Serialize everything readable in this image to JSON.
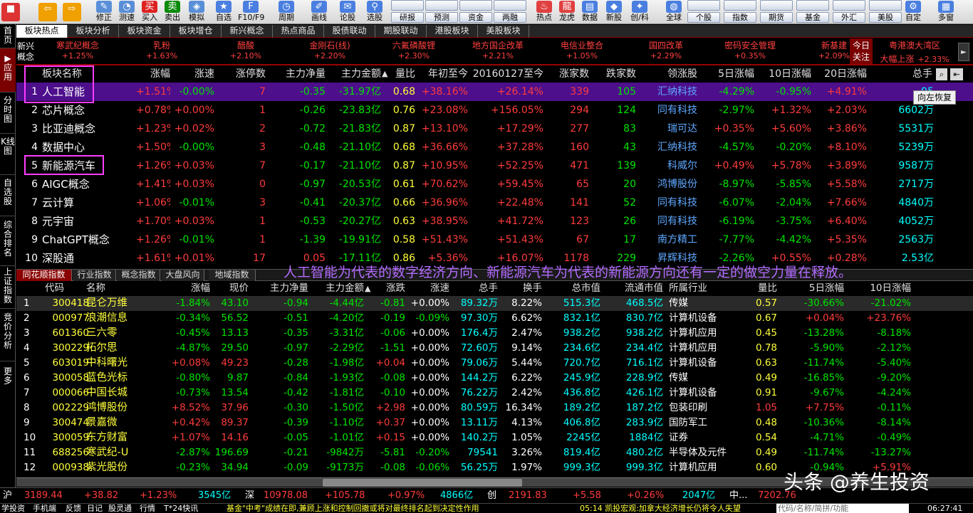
{
  "toolbar": {
    "buttons": [
      {
        "label": "",
        "icon": "app-logo-icon",
        "color": "#d33"
      },
      {
        "label": "",
        "icon": "back-arrow-icon",
        "color": "#f0a000"
      },
      {
        "label": "",
        "icon": "forward-arrow-icon",
        "color": "#f0a000"
      },
      {
        "label": "修正",
        "icon": "edit-icon",
        "color": "#5a8fd8"
      },
      {
        "label": "测速",
        "icon": "speed-icon",
        "color": "#5a8fd8"
      },
      {
        "label": "买入",
        "icon": "buy-icon",
        "color": "#d22"
      },
      {
        "label": "卖出",
        "icon": "sell-icon",
        "color": "#0a8a0a"
      },
      {
        "label": "模拟",
        "icon": "simulate-icon",
        "color": "#5a8fd8"
      },
      {
        "label": "自选",
        "icon": "star-icon",
        "color": "#4a7fe0"
      },
      {
        "label": "F10/F9",
        "icon": "f10-icon",
        "color": "#4a7fe0"
      },
      {
        "label": "周期",
        "icon": "clock-icon",
        "color": "#4a7fe0"
      },
      {
        "label": "画线",
        "icon": "pencil-icon",
        "color": "#4a7fe0"
      },
      {
        "label": "论股",
        "icon": "chat-icon",
        "color": "#4a7fe0"
      },
      {
        "label": "选股",
        "icon": "select-stock-icon",
        "color": "#4a7fe0"
      },
      {
        "label": "热点",
        "icon": "hotspot-icon",
        "color": "#e04040"
      },
      {
        "label": "龙虎",
        "icon": "dragon-tiger-icon",
        "color": "#e04040"
      },
      {
        "label": "数据",
        "icon": "data-icon",
        "color": "#4a7fe0"
      },
      {
        "label": "新股",
        "icon": "ipo-icon",
        "color": "#4a7fe0"
      },
      {
        "label": "创/科",
        "icon": "star-board-icon",
        "color": "#4a7fe0"
      },
      {
        "label": "全球",
        "icon": "globe-icon",
        "color": "#4a7fe0"
      },
      {
        "label": "自定",
        "icon": "customize-icon",
        "color": "#4a7fe0"
      },
      {
        "label": "多窗",
        "icon": "multi-window-icon",
        "color": "#4a7fe0"
      }
    ],
    "small_buttons": [
      "研报",
      "预测",
      "资金",
      "两融",
      "个股",
      "指数",
      "期货",
      "基金",
      "外汇",
      "美股"
    ]
  },
  "sidebar": [
    "首页",
    "应用",
    "分时图",
    "K线图",
    "自选股",
    "综合排名",
    "上证指数",
    "竞价分析",
    "更多"
  ],
  "top_tabs": [
    "板块热点",
    "板块分析",
    "板块资金",
    "板块增仓",
    "新兴概念",
    "热点商品",
    "股债联动",
    "期股联动",
    "港股板块",
    "美股板块"
  ],
  "emerging": {
    "title": "新兴概念",
    "items": [
      {
        "name": "寒武纪概念",
        "pct": "+1.25%"
      },
      {
        "name": "乳粉",
        "pct": "+1.63%"
      },
      {
        "name": "醋酸",
        "pct": "+2.10%"
      },
      {
        "name": "金刚石(线)",
        "pct": "+2.20%"
      },
      {
        "name": "六氟磷酸锂",
        "pct": "+2.30%"
      },
      {
        "name": "地方国企改革",
        "pct": "+2.21%"
      },
      {
        "name": "电信业整合",
        "pct": "+1.05%"
      },
      {
        "name": "国四改革",
        "pct": "+2.29%"
      },
      {
        "name": "密码安全管理",
        "pct": "+0.35%"
      },
      {
        "name": "新基建",
        "pct": "+2.09%"
      }
    ],
    "today_label": "今日关注",
    "today_item": {
      "name": "粤港澳大湾区",
      "name2": "大幅上涨",
      "pct": "+2.33%"
    }
  },
  "sector_table": {
    "headers": [
      "板块名称",
      "涨幅",
      "涨速",
      "涨停数",
      "主力净量",
      "主力金额",
      "量比",
      "年初至今",
      "20160127至今",
      "涨家数",
      "跌家数",
      "领涨股",
      "5日涨幅",
      "10日涨幅",
      "20日涨幅",
      "总手"
    ],
    "sort_arrow": "▲",
    "rows": [
      {
        "no": "1",
        "name": "人工智能",
        "pct": "+1.51%",
        "speed": "-0.00%",
        "limit": "7",
        "net": "-0.35",
        "amt": "-31.97亿",
        "vr": "0.68",
        "ytd": "+38.16%",
        "since": "+26.14%",
        "up": "339",
        "down": "105",
        "leader": "汇纳科技",
        "d5": "-4.29%",
        "d10": "-0.95%",
        "d20": "+4.91%",
        "vol": "95"
      },
      {
        "no": "2",
        "name": "芯片概念",
        "pct": "+0.78%",
        "speed": "+0.00%",
        "limit": "1",
        "net": "-0.26",
        "amt": "-23.83亿",
        "vr": "0.76",
        "ytd": "+23.08%",
        "since": "+156.05%",
        "up": "294",
        "down": "124",
        "leader": "同有科技",
        "d5": "-2.97%",
        "d10": "+1.32%",
        "d20": "+2.03%",
        "vol": "6602万"
      },
      {
        "no": "3",
        "name": "比亚迪概念",
        "pct": "+1.23%",
        "speed": "+0.02%",
        "limit": "2",
        "net": "-0.72",
        "amt": "-21.83亿",
        "vr": "0.87",
        "ytd": "+13.10%",
        "since": "+17.29%",
        "up": "277",
        "down": "83",
        "leader": "瑞可达",
        "d5": "+0.35%",
        "d10": "+5.60%",
        "d20": "+3.86%",
        "vol": "5531万"
      },
      {
        "no": "4",
        "name": "数据中心",
        "pct": "+1.50%",
        "speed": "-0.00%",
        "limit": "3",
        "net": "-0.48",
        "amt": "-21.10亿",
        "vr": "0.68",
        "ytd": "+36.66%",
        "since": "+37.28%",
        "up": "160",
        "down": "43",
        "leader": "汇纳科技",
        "d5": "-4.57%",
        "d10": "-0.20%",
        "d20": "+8.10%",
        "vol": "5239万"
      },
      {
        "no": "5",
        "name": "新能源汽车",
        "pct": "+1.26%",
        "speed": "+0.03%",
        "limit": "7",
        "net": "-0.17",
        "amt": "-21.10亿",
        "vr": "0.87",
        "ytd": "+10.95%",
        "since": "+52.25%",
        "up": "471",
        "down": "139",
        "leader": "科威尔",
        "d5": "+0.49%",
        "d10": "+5.78%",
        "d20": "+3.89%",
        "vol": "9587万"
      },
      {
        "no": "6",
        "name": "AIGC概念",
        "pct": "+1.41%",
        "speed": "+0.03%",
        "limit": "0",
        "net": "-0.97",
        "amt": "-20.53亿",
        "vr": "0.61",
        "ytd": "+70.62%",
        "since": "+59.45%",
        "up": "65",
        "down": "20",
        "leader": "鸿博股份",
        "d5": "-8.97%",
        "d10": "-5.85%",
        "d20": "+5.58%",
        "vol": "2717万"
      },
      {
        "no": "7",
        "name": "云计算",
        "pct": "+1.06%",
        "speed": "-0.01%",
        "limit": "3",
        "net": "-0.41",
        "amt": "-20.37亿",
        "vr": "0.66",
        "ytd": "+36.96%",
        "since": "+22.48%",
        "up": "141",
        "down": "52",
        "leader": "同有科技",
        "d5": "-6.07%",
        "d10": "-2.04%",
        "d20": "+7.66%",
        "vol": "4840万"
      },
      {
        "no": "8",
        "name": "元宇宙",
        "pct": "+1.70%",
        "speed": "+0.03%",
        "limit": "1",
        "net": "-0.53",
        "amt": "-20.27亿",
        "vr": "0.63",
        "ytd": "+38.95%",
        "since": "+41.72%",
        "up": "123",
        "down": "26",
        "leader": "同有科技",
        "d5": "-6.19%",
        "d10": "-3.75%",
        "d20": "+6.40%",
        "vol": "4052万"
      },
      {
        "no": "9",
        "name": "ChatGPT概念",
        "pct": "+1.26%",
        "speed": "-0.01%",
        "limit": "1",
        "net": "-1.39",
        "amt": "-19.91亿",
        "vr": "0.58",
        "ytd": "+51.43%",
        "since": "+51.43%",
        "up": "67",
        "down": "17",
        "leader": "南方精工",
        "d5": "-7.77%",
        "d10": "-4.42%",
        "d20": "+5.35%",
        "vol": "2563万"
      },
      {
        "no": "10",
        "name": "深股通",
        "pct": "+1.61%",
        "speed": "+0.01%",
        "limit": "17",
        "net": "0.05",
        "amt": "-17.11亿",
        "vr": "0.86",
        "ytd": "+5.36%",
        "since": "+16.07%",
        "up": "1178",
        "down": "229",
        "leader": "昇辉科技",
        "d5": "-2.26%",
        "d10": "+0.55%",
        "d20": "+0.28%",
        "vol": "2.53亿"
      }
    ]
  },
  "tooltip": "向左恢复",
  "bottom_tabs": [
    "同花顺指数",
    "行业指数",
    "概念指数",
    "大盘风向",
    "地域指数"
  ],
  "banner": "人工智能为代表的数字经济方向、新能源汽车为代表的新能源方向还有一定的做空力量在释放。",
  "stock_table": {
    "headers": [
      "代码",
      "名称",
      "涨幅",
      "现价",
      "主力净量",
      "主力金额",
      "涨跌",
      "涨速",
      "总手",
      "换手",
      "总市值",
      "流通市值",
      "所属行业",
      "量比",
      "5日涨幅",
      "10日涨幅"
    ],
    "rows": [
      {
        "no": "1",
        "code": "300418",
        "name": "昆仑万维",
        "pct": "-1.84%",
        "price": "43.10",
        "net": "-0.94",
        "amt": "-4.44亿",
        "chg": "-0.81",
        "speed": "+0.00%",
        "vol": "89.32万",
        "turn": "8.22%",
        "mcap": "515.3亿",
        "fcap": "468.5亿",
        "ind": "传媒",
        "vr": "0.57",
        "d5": "-30.66%",
        "d10": "-21.02%"
      },
      {
        "no": "2",
        "code": "000977",
        "name": "浪潮信息",
        "pct": "-0.34%",
        "price": "56.52",
        "net": "-0.51",
        "amt": "-4.20亿",
        "chg": "-0.19",
        "speed": "-0.09%",
        "vol": "97.30万",
        "turn": "6.62%",
        "mcap": "832.1亿",
        "fcap": "830.7亿",
        "ind": "计算机设备",
        "vr": "0.67",
        "d5": "+0.04%",
        "d10": "+23.76%"
      },
      {
        "no": "3",
        "code": "601360",
        "name": "三六零",
        "pct": "-0.45%",
        "price": "13.13",
        "net": "-0.35",
        "amt": "-3.31亿",
        "chg": "-0.06",
        "speed": "+0.00%",
        "vol": "176.4万",
        "turn": "2.47%",
        "mcap": "938.2亿",
        "fcap": "938.2亿",
        "ind": "计算机应用",
        "vr": "0.45",
        "d5": "-13.28%",
        "d10": "-8.18%"
      },
      {
        "no": "4",
        "code": "300229",
        "name": "拓尔思",
        "pct": "-4.87%",
        "price": "29.50",
        "net": "-0.97",
        "amt": "-2.29亿",
        "chg": "-1.51",
        "speed": "+0.00%",
        "vol": "72.60万",
        "turn": "9.14%",
        "mcap": "234.6亿",
        "fcap": "234.4亿",
        "ind": "计算机应用",
        "vr": "0.78",
        "d5": "-5.90%",
        "d10": "-2.12%"
      },
      {
        "no": "5",
        "code": "603019",
        "name": "中科曙光",
        "pct": "+0.08%",
        "price": "49.23",
        "net": "-0.28",
        "amt": "-1.98亿",
        "chg": "+0.04",
        "speed": "+0.00%",
        "vol": "79.06万",
        "turn": "5.44%",
        "mcap": "720.7亿",
        "fcap": "716.1亿",
        "ind": "计算机设备",
        "vr": "0.63",
        "d5": "-11.74%",
        "d10": "-5.40%"
      },
      {
        "no": "6",
        "code": "300058",
        "name": "蓝色光标",
        "pct": "-0.80%",
        "price": "9.87",
        "net": "-0.84",
        "amt": "-1.93亿",
        "chg": "-0.08",
        "speed": "+0.00%",
        "vol": "144.2万",
        "turn": "6.22%",
        "mcap": "245.9亿",
        "fcap": "228.9亿",
        "ind": "传媒",
        "vr": "0.49",
        "d5": "-16.85%",
        "d10": "-9.20%"
      },
      {
        "no": "7",
        "code": "000066",
        "name": "中国长城",
        "pct": "-0.73%",
        "price": "13.54",
        "net": "-0.42",
        "amt": "-1.81亿",
        "chg": "-0.10",
        "speed": "+0.00%",
        "vol": "76.22万",
        "turn": "2.42%",
        "mcap": "436.8亿",
        "fcap": "426.1亿",
        "ind": "计算机设备",
        "vr": "0.91",
        "d5": "-9.67%",
        "d10": "-4.24%"
      },
      {
        "no": "8",
        "code": "002229",
        "name": "鸿博股份",
        "pct": "+8.52%",
        "price": "37.96",
        "net": "-0.30",
        "amt": "-1.50亿",
        "chg": "+2.98",
        "speed": "+0.00%",
        "vol": "80.59万",
        "turn": "16.34%",
        "mcap": "189.2亿",
        "fcap": "187.2亿",
        "ind": "包装印刷",
        "vr": "1.05",
        "d5": "+7.75%",
        "d10": "-0.11%"
      },
      {
        "no": "9",
        "code": "300474",
        "name": "景嘉微",
        "pct": "+0.42%",
        "price": "89.37",
        "net": "-0.39",
        "amt": "-1.10亿",
        "chg": "+0.37",
        "speed": "+0.00%",
        "vol": "13.11万",
        "turn": "4.13%",
        "mcap": "406.8亿",
        "fcap": "283.9亿",
        "ind": "国防军工",
        "vr": "0.48",
        "d5": "-10.36%",
        "d10": "-8.14%"
      },
      {
        "no": "10",
        "code": "300059",
        "name": "东方财富",
        "pct": "+1.07%",
        "price": "14.16",
        "net": "-0.05",
        "amt": "-1.01亿",
        "chg": "+0.15",
        "speed": "+0.00%",
        "vol": "140.2万",
        "turn": "1.05%",
        "mcap": "2245亿",
        "fcap": "1884亿",
        "ind": "证券",
        "vr": "0.54",
        "d5": "-4.71%",
        "d10": "-0.49%"
      },
      {
        "no": "11",
        "code": "688256",
        "name": "寒武纪-U",
        "pct": "-2.87%",
        "price": "196.69",
        "net": "-0.21",
        "amt": "-9842万",
        "chg": "-5.81",
        "speed": "-0.20%",
        "vol": "79541",
        "turn": "3.26%",
        "mcap": "819.4亿",
        "fcap": "480.2亿",
        "ind": "半导体及元件",
        "vr": "0.49",
        "d5": "-11.74%",
        "d10": "-13.27%"
      },
      {
        "no": "12",
        "code": "000938",
        "name": "紫光股份",
        "pct": "-0.23%",
        "price": "34.94",
        "net": "-0.09",
        "amt": "-9173万",
        "chg": "-0.08",
        "speed": "-0.06%",
        "vol": "56.25万",
        "turn": "1.97%",
        "mcap": "999.3亿",
        "fcap": "999.3亿",
        "ind": "计算机应用",
        "vr": "0.60",
        "d5": "-0.94%",
        "d10": "+5.91%"
      }
    ]
  },
  "index_bar": {
    "sh_label": "沪",
    "sh_val": "3189.44",
    "sh_chg": "+38.82",
    "sh_pct": "+1.23%",
    "sh_amt": "3545亿",
    "sz_label": "深",
    "sz_val": "10978.08",
    "sz_chg": "+105.78",
    "sz_pct": "+0.97%",
    "sz_amt": "4866亿",
    "cy_label": "创",
    "cy_val": "2191.83",
    "cy_chg": "+5.58",
    "cy_pct": "+0.26%",
    "cy_amt": "2047亿",
    "zz_label": "中...",
    "zz_val": "7202.76"
  },
  "status_bar": {
    "items": [
      "学投资",
      "手机端",
      "反馈",
      "日记",
      "股灵通",
      "行情",
      "T*24快讯"
    ],
    "news1": "基金\"中考\"成绩在即,兼顾上涨和控制回撤或将对最终排名起到决定性作用",
    "news2": "05:14 凯投宏观:加拿大经济增长仍将令人失望",
    "search_hint": "代码/名称/简拼/功能",
    "time": "06:27:41"
  },
  "watermark": "头条 @养生投资"
}
